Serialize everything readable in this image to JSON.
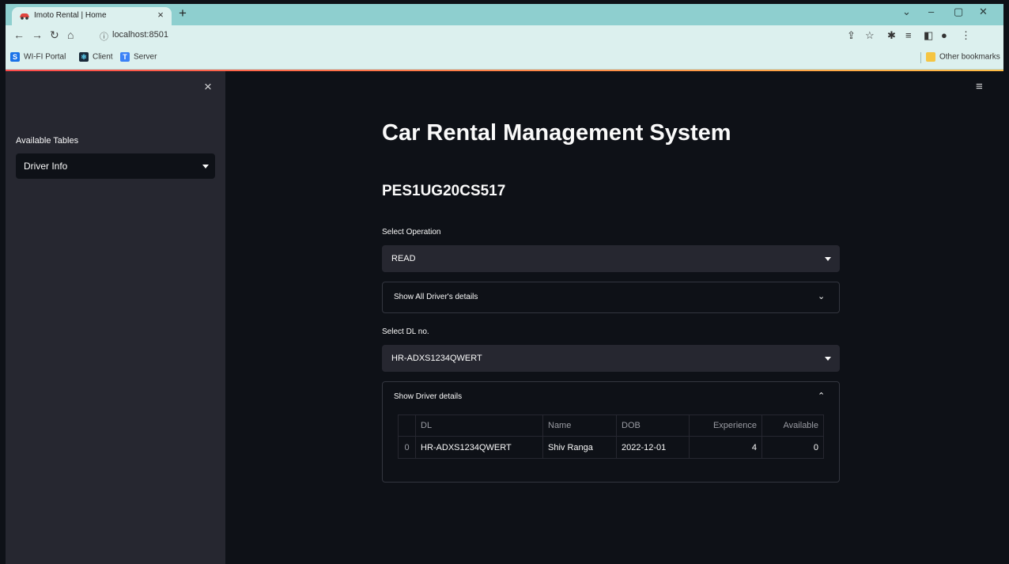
{
  "browser": {
    "tab_title": "Imoto Rental | Home",
    "tab_close": "×",
    "new_tab": "+",
    "url": "localhost:8501",
    "window_controls": [
      "⌄",
      "–",
      "▢",
      "✕"
    ],
    "bookmarks": [
      {
        "label": "WI-FI Portal",
        "icon": "S",
        "color": "#1a73e8"
      },
      {
        "label": "Client",
        "icon": "⚛",
        "color": "#1a2a3a"
      },
      {
        "label": "Server",
        "icon": "T",
        "color": "#3b82f6"
      }
    ],
    "other_bookmarks": "Other bookmarks"
  },
  "sidebar": {
    "close": "×",
    "label": "Available Tables",
    "selected": "Driver Info"
  },
  "main": {
    "menu": "≡",
    "title": "Car Rental Management System",
    "subtitle": "PES1UG20CS517",
    "operation_label": "Select Operation",
    "operation_value": "READ",
    "all_drivers_expander": "Show All Driver's details",
    "dl_label": "Select DL no.",
    "dl_value": "HR-ADXS1234QWERT",
    "driver_expander": "Show Driver details",
    "table": {
      "headers": [
        "",
        "DL",
        "Name",
        "DOB",
        "Experience",
        "Available"
      ],
      "rows": [
        {
          "index": "0",
          "dl": "HR-ADXS1234QWERT",
          "name": "Shiv Ranga",
          "dob": "2022-12-01",
          "experience": "4",
          "available": "0"
        }
      ]
    }
  },
  "colors": {
    "background": "#0e1117",
    "sidebar": "#262730",
    "accent": "#ff4b4b",
    "tabstrip": "#8ecfcf"
  }
}
